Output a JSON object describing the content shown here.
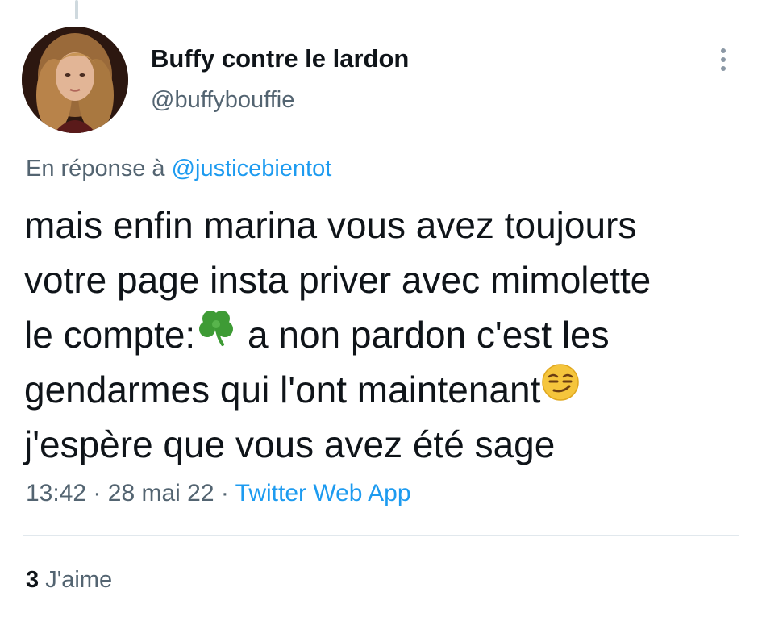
{
  "tweet": {
    "author": {
      "display_name": "Buffy contre le lardon",
      "handle": "@buffybouffie"
    },
    "reply_prefix": "En réponse à",
    "reply_to": "@justicebientot",
    "text_lines": [
      "mais enfin marina vous avez toujours",
      "votre page insta priver avec mimolette",
      "le compte:",
      "a non pardon c'est les",
      "gendarmes qui l'ont maintenant",
      "j'espère que vous avez été sage"
    ],
    "time": "13:42",
    "separator": "·",
    "date": "28 mai 22",
    "source": "Twitter Web App",
    "likes_count": "3",
    "likes_label": "J'aime"
  },
  "icons": {
    "more": "more-vertical-icon",
    "clover": "four-leaf-clover-emoji",
    "smirk": "smirking-face-emoji"
  },
  "colors": {
    "text": "#0f1419",
    "secondary": "#536471",
    "link": "#1d9bf0",
    "divider": "#e1e8ed"
  }
}
